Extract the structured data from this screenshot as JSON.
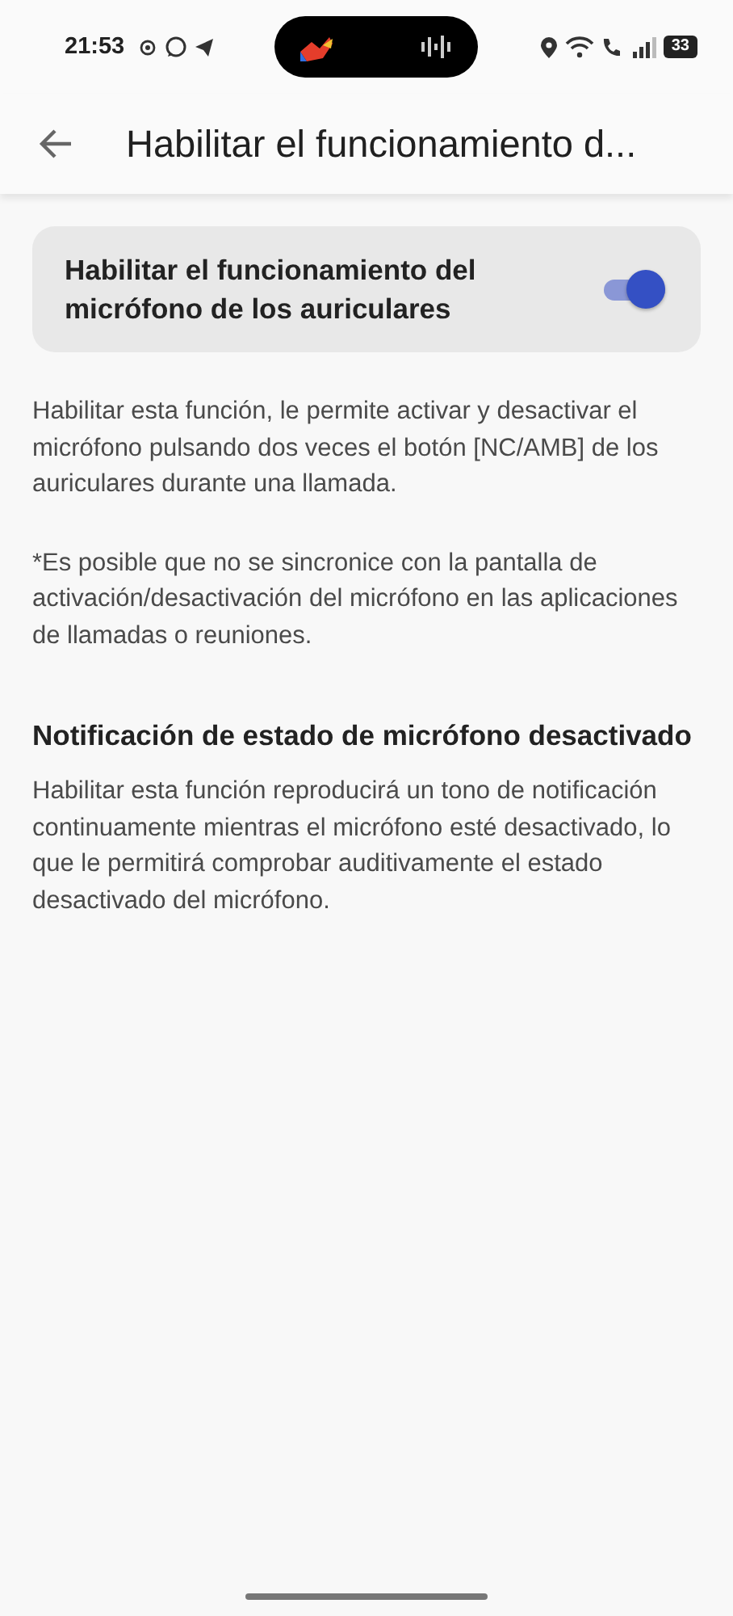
{
  "status_bar": {
    "time": "21:53",
    "battery": "33"
  },
  "app_bar": {
    "title": "Habilitar el funcionamiento d..."
  },
  "setting": {
    "label": "Habilitar el funcionamiento del micrófono de los auriculares",
    "on": true
  },
  "paragraphs": [
    "Habilitar esta función, le permite activar y desactivar el micrófono pulsando dos veces el botón [NC/AMB] de los auriculares durante una llamada.",
    "*Es posible que no se sincronice con la pantalla de activación/desactivación del micrófono en las aplicaciones de llamadas o reuniones."
  ],
  "section": {
    "heading": "Notificación de estado de micrófono desactivado",
    "body": "Habilitar esta función reproducirá un tono de notificación continuamente mientras el micrófono esté desactivado, lo que le permitirá comprobar auditivamente el estado desactivado del micrófono."
  }
}
